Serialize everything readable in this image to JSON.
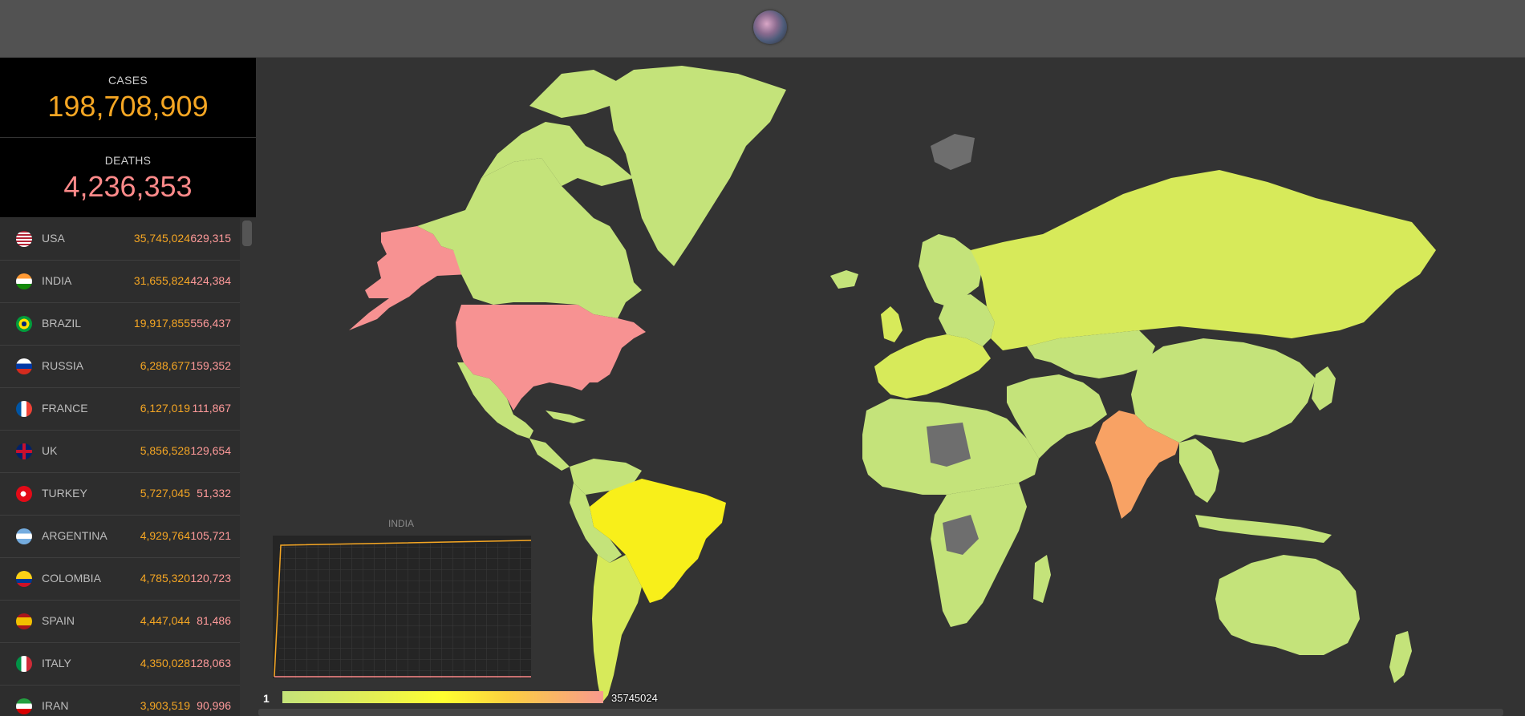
{
  "header": {
    "logo_icon": "globe-virus-icon"
  },
  "totals": {
    "cases_label": "CASES",
    "cases_value": "198,708,909",
    "deaths_label": "DEATHS",
    "deaths_value": "4,236,353"
  },
  "countries": [
    {
      "name": "USA",
      "cases": "35,745,024",
      "deaths": "629,315",
      "flag": "flag-usa-icon"
    },
    {
      "name": "INDIA",
      "cases": "31,655,824",
      "deaths": "424,384",
      "flag": "flag-india-icon"
    },
    {
      "name": "BRAZIL",
      "cases": "19,917,855",
      "deaths": "556,437",
      "flag": "flag-brazil-icon"
    },
    {
      "name": "RUSSIA",
      "cases": "6,288,677",
      "deaths": "159,352",
      "flag": "flag-russia-icon"
    },
    {
      "name": "FRANCE",
      "cases": "6,127,019",
      "deaths": "111,867",
      "flag": "flag-france-icon"
    },
    {
      "name": "UK",
      "cases": "5,856,528",
      "deaths": "129,654",
      "flag": "flag-uk-icon"
    },
    {
      "name": "TURKEY",
      "cases": "5,727,045",
      "deaths": "51,332",
      "flag": "flag-turkey-icon"
    },
    {
      "name": "ARGENTINA",
      "cases": "4,929,764",
      "deaths": "105,721",
      "flag": "flag-argentina-icon"
    },
    {
      "name": "COLOMBIA",
      "cases": "4,785,320",
      "deaths": "120,723",
      "flag": "flag-colombia-icon"
    },
    {
      "name": "SPAIN",
      "cases": "4,447,044",
      "deaths": "81,486",
      "flag": "flag-spain-icon"
    },
    {
      "name": "ITALY",
      "cases": "4,350,028",
      "deaths": "128,063",
      "flag": "flag-italy-icon"
    },
    {
      "name": "IRAN",
      "cases": "3,903,519",
      "deaths": "90,996",
      "flag": "flag-iran-icon"
    }
  ],
  "mini_chart": {
    "title": "INDIA"
  },
  "legend": {
    "min": "1",
    "max": "35745024"
  },
  "colors": {
    "cases": "#f5a623",
    "deaths": "#ff8a8a",
    "land_default": "#c4e37a",
    "usa": "#f79292",
    "india": "#f8a264",
    "brazil": "#f8ef1a",
    "russia": "#d7ea5a",
    "no_data": "#6e6e6e"
  }
}
